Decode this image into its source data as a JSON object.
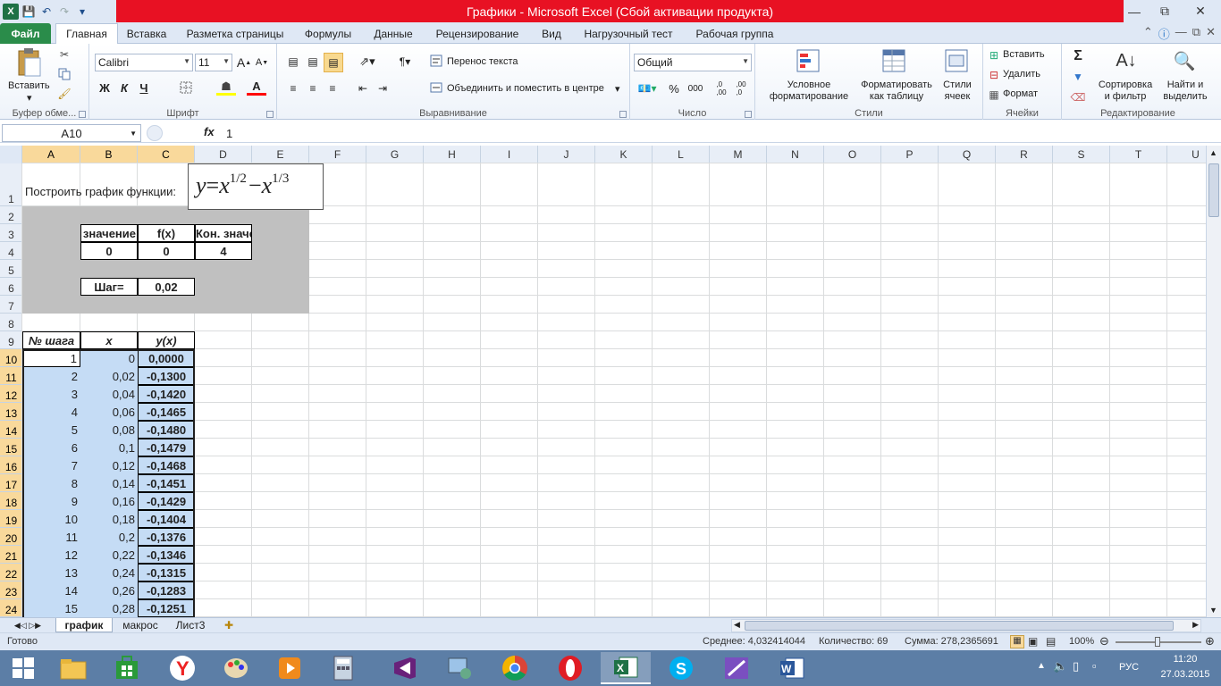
{
  "window": {
    "title": "Графики - Microsoft Excel (Сбой активации продукта)"
  },
  "qat": {
    "logo": "X",
    "save": "💾",
    "undo": "↶",
    "redo": "↷",
    "more": "▾"
  },
  "tabs": [
    {
      "label": "Файл"
    },
    {
      "label": "Главная"
    },
    {
      "label": "Вставка"
    },
    {
      "label": "Разметка страницы"
    },
    {
      "label": "Формулы"
    },
    {
      "label": "Данные"
    },
    {
      "label": "Рецензирование"
    },
    {
      "label": "Вид"
    },
    {
      "label": "Нагрузочный тест"
    },
    {
      "label": "Рабочая группа"
    }
  ],
  "ribbon": {
    "clipboard": {
      "label": "Буфер обме...",
      "paste": "Вставить"
    },
    "font": {
      "label": "Шрифт",
      "name": "Calibri",
      "size": "11",
      "bold": "Ж",
      "italic": "К",
      "underline": "Ч",
      "grow": "A",
      "shrink": "A"
    },
    "alignment": {
      "label": "Выравнивание",
      "wrap": "Перенос текста",
      "merge": "Объединить и поместить в центре"
    },
    "number": {
      "label": "Число",
      "format": "Общий",
      "percent": "%",
      "thousands": "000",
      "inc": ",0→,00",
      "dec": ",00→,0"
    },
    "styles": {
      "label": "Стили",
      "conditional": "Условное форматирование",
      "as_table": "Форматировать как таблицу",
      "cell_styles": "Стили ячеек"
    },
    "cells": {
      "label": "Ячейки",
      "insert": "Вставить",
      "delete": "Удалить",
      "format": "Формат"
    },
    "editing": {
      "label": "Редактирование",
      "sum": "Σ",
      "sort": "Сортировка и фильтр",
      "find": "Найти и выделить"
    }
  },
  "formula_bar": {
    "name_box": "A10",
    "fx": "fx",
    "value": "1"
  },
  "columns": [
    "A",
    "B",
    "C",
    "D",
    "E",
    "F",
    "G",
    "H",
    "I",
    "J",
    "K",
    "L",
    "M",
    "N",
    "O",
    "P",
    "Q",
    "R",
    "S",
    "T",
    "U"
  ],
  "rows": [
    "1",
    "2",
    "3",
    "4",
    "5",
    "6",
    "7",
    "8",
    "9",
    "10",
    "11",
    "12",
    "13",
    "14",
    "15",
    "16",
    "17",
    "18",
    "19",
    "20",
    "21",
    "22",
    "23",
    "24"
  ],
  "sheet": {
    "title": "Построить график функции:",
    "formula": {
      "y": "y",
      "eq": "=",
      "x": "x",
      "e1": "1/2",
      "minus": "−",
      "e2": "1/3"
    },
    "params": {
      "h_start": "Нач. значение",
      "h_fx": "f(x)",
      "h_end": "Кон. значение",
      "start": "0",
      "fx": "0",
      "end": "4",
      "step_label": "Шаг=",
      "step": "0,02"
    },
    "table_headers": {
      "n": "№ шага",
      "x": "x",
      "y": "y(x)"
    },
    "table_rows": [
      {
        "n": "1",
        "x": "0",
        "y": "0,0000"
      },
      {
        "n": "2",
        "x": "0,02",
        "y": "-0,1300"
      },
      {
        "n": "3",
        "x": "0,04",
        "y": "-0,1420"
      },
      {
        "n": "4",
        "x": "0,06",
        "y": "-0,1465"
      },
      {
        "n": "5",
        "x": "0,08",
        "y": "-0,1480"
      },
      {
        "n": "6",
        "x": "0,1",
        "y": "-0,1479"
      },
      {
        "n": "7",
        "x": "0,12",
        "y": "-0,1468"
      },
      {
        "n": "8",
        "x": "0,14",
        "y": "-0,1451"
      },
      {
        "n": "9",
        "x": "0,16",
        "y": "-0,1429"
      },
      {
        "n": "10",
        "x": "0,18",
        "y": "-0,1404"
      },
      {
        "n": "11",
        "x": "0,2",
        "y": "-0,1376"
      },
      {
        "n": "12",
        "x": "0,22",
        "y": "-0,1346"
      },
      {
        "n": "13",
        "x": "0,24",
        "y": "-0,1315"
      },
      {
        "n": "14",
        "x": "0,26",
        "y": "-0,1283"
      },
      {
        "n": "15",
        "x": "0,28",
        "y": "-0,1251"
      }
    ]
  },
  "sheet_tabs": [
    {
      "label": "график"
    },
    {
      "label": "макрос"
    },
    {
      "label": "Лист3"
    }
  ],
  "status": {
    "ready": "Готово",
    "average": "Среднее: 4,032414044",
    "count": "Количество: 69",
    "sum": "Сумма: 278,2365691",
    "zoom": "100%"
  },
  "taskbar": {
    "lang": "РУС",
    "time": "11:20",
    "date": "27.03.2015"
  },
  "colors": {
    "title_red": "#e81123",
    "file_green": "#2a8c4a",
    "selection": "#c5dcf5",
    "param_grey": "#c0c0c0",
    "header_sel": "#f9d99b"
  }
}
